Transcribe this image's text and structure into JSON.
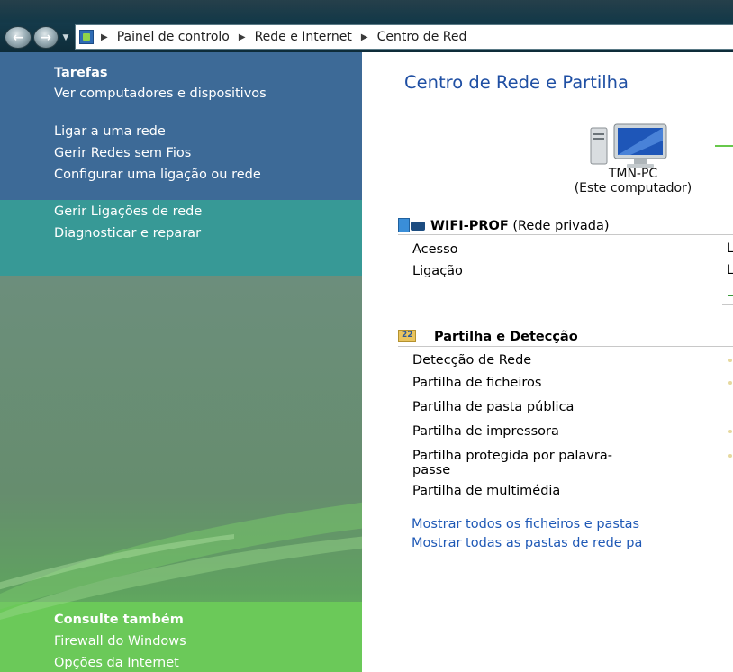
{
  "navbar": {
    "back_icon": "back-arrow-icon",
    "forward_icon": "forward-arrow-icon",
    "breadcrumbs": [
      "Painel de controlo",
      "Rede e Internet",
      "Centro de Red"
    ]
  },
  "sidebar": {
    "tasks_title": "Tarefas",
    "tasks": [
      "Ver computadores e dispositivos",
      "Ligar a uma rede",
      "Gerir Redes sem Fios",
      "Configurar uma ligação ou rede",
      "Gerir Ligações de rede",
      "Diagnosticar e reparar"
    ],
    "see_also_title": "Consulte também",
    "see_also": [
      "Firewall do Windows",
      "Opções da Internet"
    ]
  },
  "main": {
    "title": "Centro de Rede e Partilha",
    "computer_name": "TMN-PC",
    "computer_caption": "(Este computador)",
    "network": {
      "name": "WIFI-PROF",
      "type": "(Rede privada)",
      "rows": [
        {
          "label": "Acesso",
          "value": "L"
        },
        {
          "label": "Ligação",
          "value": "L"
        }
      ]
    },
    "sharing": {
      "title": "Partilha e Detecção",
      "rows": [
        "Detecção de Rede",
        "Partilha de ficheiros",
        "Partilha de pasta pública",
        "Partilha de impressora",
        "Partilha protegida por palavra-passe",
        "Partilha de multimédia"
      ]
    },
    "links": [
      "Mostrar todos os ficheiros e pastas",
      "Mostrar todas as pastas de rede pa"
    ]
  },
  "colors": {
    "title_blue": "#1f4fa3",
    "link_blue": "#1f59b6",
    "pane_blue": "#3d6a97",
    "pane_teal": "#379996",
    "pane_green": "#6bc959"
  }
}
